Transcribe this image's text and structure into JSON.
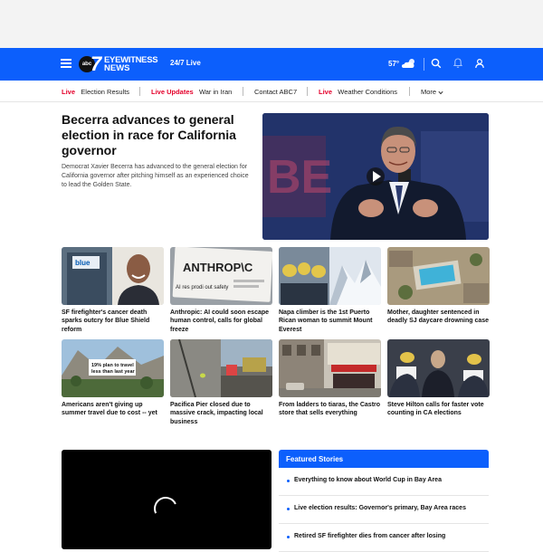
{
  "header": {
    "logo_network": "abc",
    "logo_number": "7",
    "logo_line1": "EYEWITNESS",
    "logo_line2": "NEWS",
    "live_label": "24/7 Live",
    "temperature": "57°",
    "weather_icon": "partly-cloudy-icon",
    "brand_color": "#0c5ffc"
  },
  "subnav": {
    "items": [
      {
        "badge": "Live",
        "label": "Election Results"
      },
      {
        "badge": "Live Updates",
        "label": "War in Iran"
      },
      {
        "badge": "",
        "label": "Contact ABC7"
      },
      {
        "badge": "Live",
        "label": "Weather Conditions"
      },
      {
        "badge": "",
        "label": "More"
      }
    ],
    "live_color": "#e4002b"
  },
  "hero": {
    "title": "Becerra advances to general election in race for California governor",
    "description": "Democrat Xavier Becerra has advanced to the general election for California governor after pitching himself as an experienced choice to lead the Golden State."
  },
  "cards": [
    {
      "caption": "SF firefighter's cancer death sparks outcry for Blue Shield reform"
    },
    {
      "caption": "Anthropic: AI could soon escape human control, calls for global freeze",
      "image_text": "ANTHROP\\C",
      "image_subtext": "AI res prodi out safety"
    },
    {
      "caption": "Napa climber is the 1st Puerto Rican woman to summit Mount Everest"
    },
    {
      "caption": "Mother, daughter sentenced in deadly SJ daycare drowning case"
    },
    {
      "caption": "Americans aren't giving up summer travel due to cost -- yet",
      "image_text": "19% plan to travel less than last year"
    },
    {
      "caption": "Pacifica Pier closed due to massive crack, impacting local business"
    },
    {
      "caption": "From ladders to tiaras, the Castro store that sells everything"
    },
    {
      "caption": "Steve Hilton calls for faster vote counting in CA elections"
    }
  ],
  "featured": {
    "heading": "Featured Stories",
    "items": [
      "Everything to know about World Cup in Bay Area",
      "Live election results: Governor's primary, Bay Area races",
      "Retired SF firefighter dies from cancer after losing"
    ]
  }
}
